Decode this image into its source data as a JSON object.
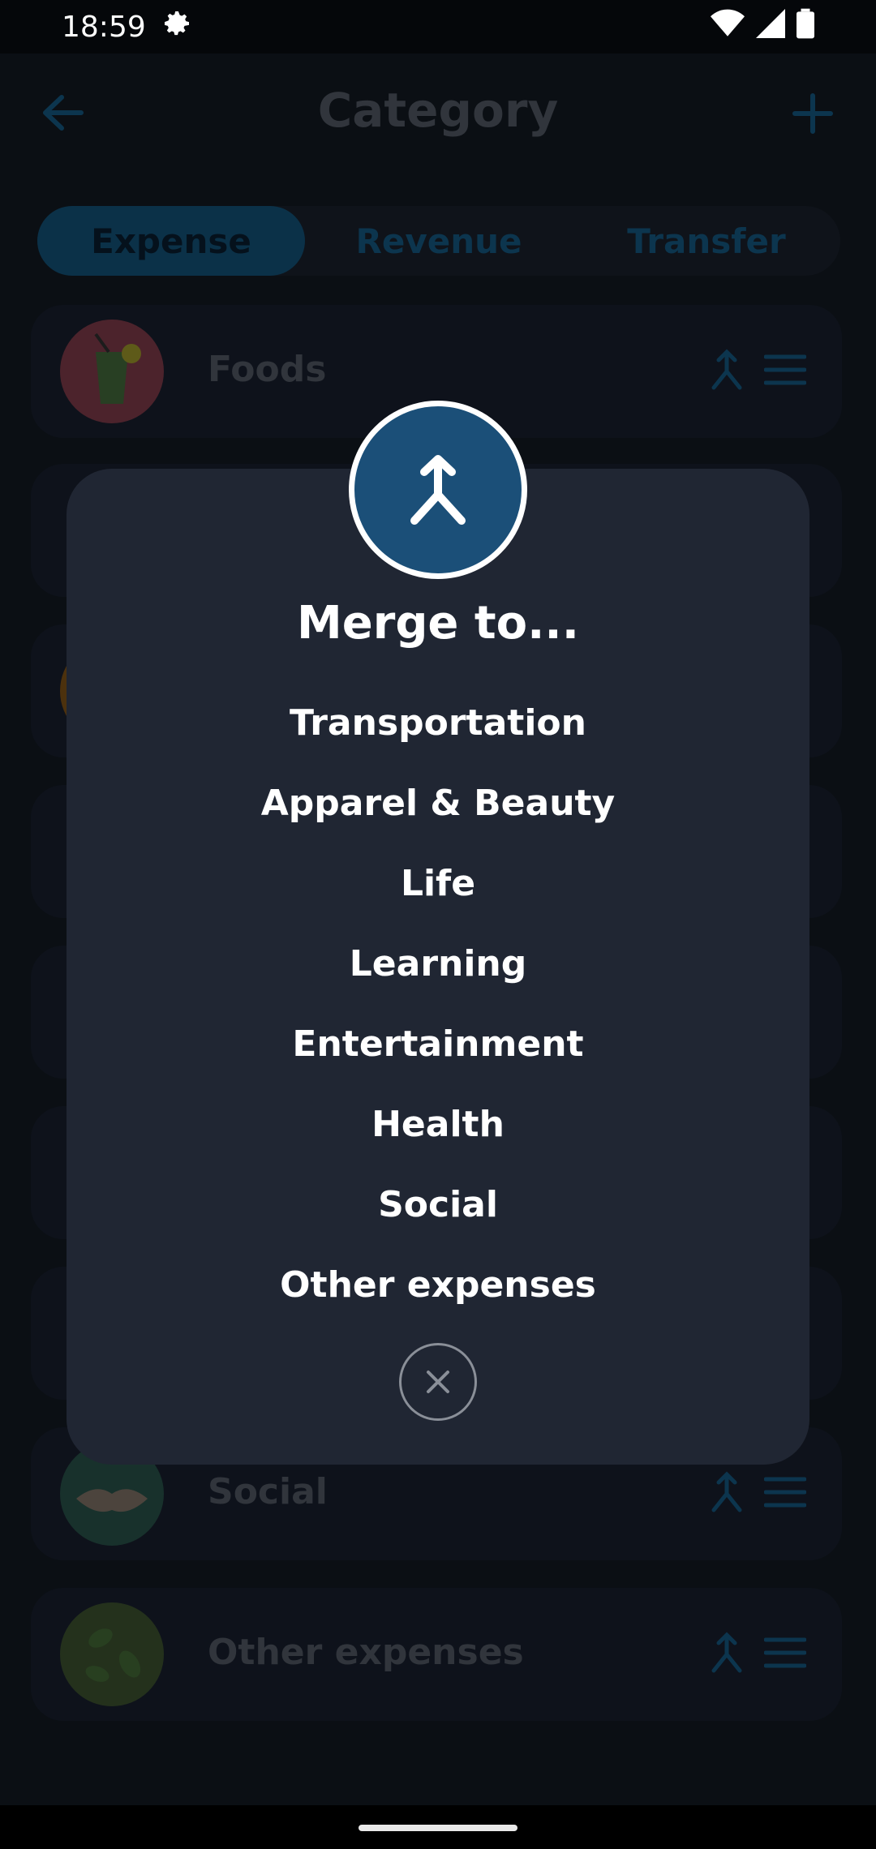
{
  "status_bar": {
    "time": "18:59"
  },
  "header": {
    "title": "Category"
  },
  "tabs": [
    {
      "label": "Expense",
      "active": true
    },
    {
      "label": "Revenue",
      "active": false
    },
    {
      "label": "Transfer",
      "active": false
    }
  ],
  "background_rows": [
    {
      "name": "Foods"
    },
    {
      "name": "Social"
    },
    {
      "name": "Other expenses"
    }
  ],
  "dialog": {
    "title": "Merge to...",
    "options": [
      "Transportation",
      "Apparel & Beauty",
      "Life",
      "Learning",
      "Entertainment",
      "Health",
      "Social",
      "Other expenses"
    ]
  },
  "colors": {
    "accent": "#1b4f78",
    "dialog_bg": "#202633",
    "background": "#0e1218"
  }
}
